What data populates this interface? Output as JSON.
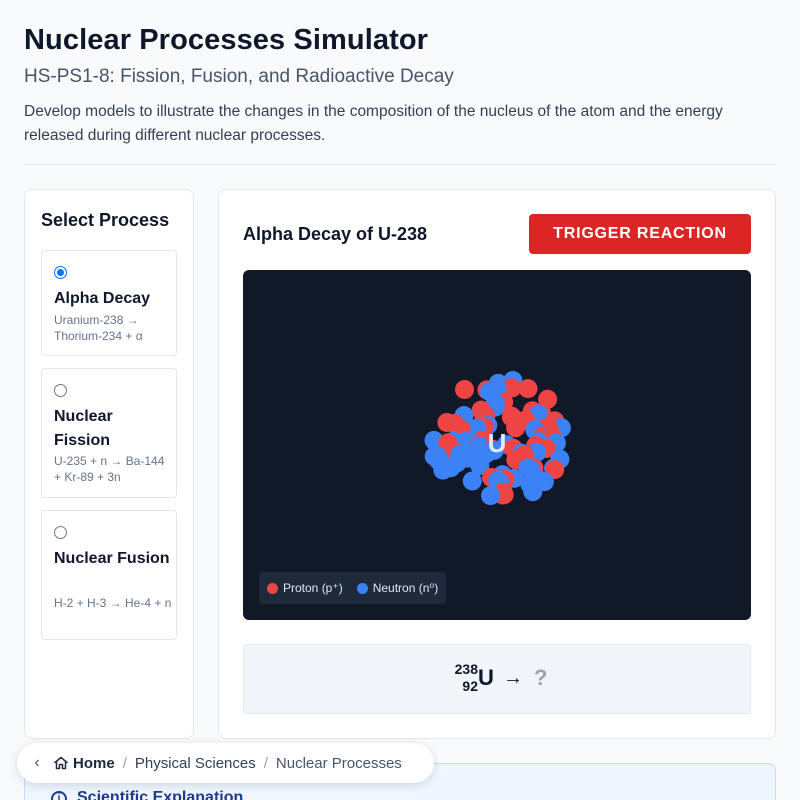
{
  "header": {
    "title": "Nuclear Processes Simulator",
    "subtitle": "HS-PS1-8: Fission, Fusion, and Radioactive Decay",
    "description": "Develop models to illustrate the changes in the composition of the nucleus of the atom and the energy released during different nuclear processes."
  },
  "sidebar": {
    "heading": "Select Process",
    "options": [
      {
        "name": "Alpha Decay",
        "equation": "Uranium-238 → Thorium-234 + α",
        "selected": true
      },
      {
        "name": "Nuclear Fission",
        "equation": "U-235 + n → Ba-144 + Kr-89 + 3n",
        "selected": false
      },
      {
        "name": "Nuclear Fusion",
        "equation": "H-2 + H-3 → He-4 + n",
        "selected": false
      }
    ]
  },
  "main": {
    "heading": "Alpha Decay of U-238",
    "trigger_label": "TRIGGER REACTION",
    "nucleus_symbol": "U",
    "legend": {
      "proton_label": "Proton (p⁺)",
      "neutron_label": "Neutron (n⁰)",
      "proton_color": "#ef4444",
      "neutron_color": "#3b82f6"
    },
    "equation": {
      "mass_number": "238",
      "atomic_number": "92",
      "symbol": "U",
      "arrow": "→",
      "product": "?"
    }
  },
  "breadcrumb": {
    "back_icon": "chevron-left-icon",
    "home_icon": "home-icon",
    "home": "Home",
    "category": "Physical Sciences",
    "current": "Nuclear Processes"
  },
  "explanation": {
    "title": "Scientific Explanation",
    "icon": "info-icon"
  },
  "colors": {
    "accent_red": "#dc2626",
    "stage_bg": "#111827",
    "selected_radio": "#0075ff"
  }
}
